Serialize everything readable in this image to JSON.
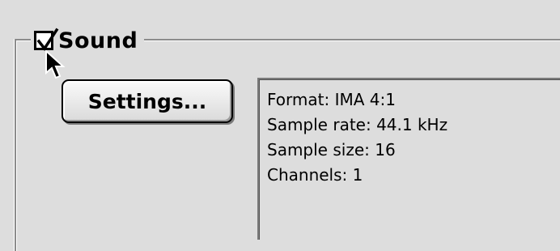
{
  "sound_group": {
    "label": "Sound",
    "enabled": true
  },
  "settings_button": {
    "label": "Settings..."
  },
  "format_info": {
    "lines": [
      "Format: IMA 4:1",
      "Sample rate: 44.1 kHz",
      "Sample size: 16",
      "Channels: 1"
    ]
  },
  "icons": {
    "checkbox": "checkmark-icon",
    "pointer": "arrow-cursor-icon"
  }
}
